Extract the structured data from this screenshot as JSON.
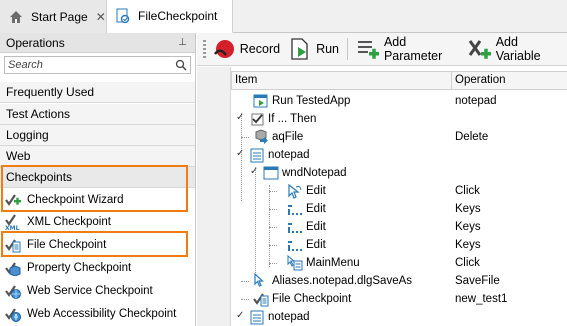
{
  "tabs": [
    {
      "label": "Start Page",
      "close": "✕"
    },
    {
      "label": "FileCheckpoint"
    }
  ],
  "left_panel": {
    "title": "Operations",
    "pin": "⊥",
    "search_placeholder": "Search",
    "categories": [
      "Frequently Used",
      "Test Actions",
      "Logging",
      "Web",
      "Checkpoints"
    ],
    "operations": [
      {
        "label": "Checkpoint Wizard",
        "icon": "checkpoint-wizard-icon"
      },
      {
        "label": "XML Checkpoint",
        "icon": "xml-checkpoint-icon"
      },
      {
        "label": "File Checkpoint",
        "icon": "file-checkpoint-icon"
      },
      {
        "label": "Property Checkpoint",
        "icon": "property-checkpoint-icon"
      },
      {
        "label": "Web Service Checkpoint",
        "icon": "web-service-checkpoint-icon"
      },
      {
        "label": "Web Accessibility Checkpoint",
        "icon": "web-accessibility-checkpoint-icon"
      }
    ],
    "highlight_color": "#f07c12"
  },
  "toolbar": {
    "record_label": "Record",
    "run_label": "Run",
    "add_parameter_label": "Add Parameter",
    "add_variable_label": "Add Variable"
  },
  "grid": {
    "columns": [
      "Item",
      "Operation"
    ],
    "rows": [
      {
        "item": "Run TestedApp",
        "operation": "notepad"
      },
      {
        "item": "If ... Then",
        "operation": ""
      },
      {
        "item": "aqFile",
        "operation": "Delete"
      },
      {
        "item": "notepad",
        "operation": ""
      },
      {
        "item": "wndNotepad",
        "operation": ""
      },
      {
        "item": "Edit",
        "operation": "Click"
      },
      {
        "item": "Edit",
        "operation": "Keys"
      },
      {
        "item": "Edit",
        "operation": "Keys"
      },
      {
        "item": "Edit",
        "operation": "Keys"
      },
      {
        "item": "MainMenu",
        "operation": "Click"
      },
      {
        "item": "Aliases.notepad.dlgSaveAs",
        "operation": "SaveFile"
      },
      {
        "item": "File Checkpoint",
        "operation": "new_test1"
      },
      {
        "item": "notepad",
        "operation": ""
      }
    ]
  }
}
